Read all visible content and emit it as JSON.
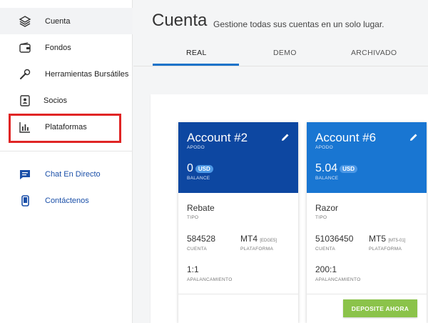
{
  "sidebar": {
    "items": [
      {
        "label": "Cuenta",
        "icon": "layers-icon"
      },
      {
        "label": "Fondos",
        "icon": "wallet-icon"
      },
      {
        "label": "Herramientas Bursátiles",
        "icon": "wrench-icon"
      },
      {
        "label": "Socios",
        "icon": "contacts-book-icon"
      },
      {
        "label": "Plataformas",
        "icon": "bar-chart-icon"
      }
    ],
    "support": [
      {
        "label": "Chat En Directo",
        "icon": "chat-icon"
      },
      {
        "label": "Contáctenos",
        "icon": "phone-icon"
      }
    ]
  },
  "header": {
    "title": "Cuenta",
    "subtitle": "Gestione todas sus cuentas en un solo lugar."
  },
  "tabs": [
    {
      "label": "REAL",
      "active": true
    },
    {
      "label": "DEMO",
      "active": false
    },
    {
      "label": "ARCHIVADO",
      "active": false
    }
  ],
  "accounts": [
    {
      "name": "Account #2",
      "nick_label": "APODO",
      "balance": "0",
      "currency": "USD",
      "balance_label": "BALANCE",
      "type": "Rebate",
      "type_label": "TIPO",
      "account_number": "584528",
      "account_label": "CUENTA",
      "platform": "MT4",
      "platform_sub": "[EDGE5]",
      "platform_label": "PLATAFORMA",
      "leverage": "1:1",
      "leverage_label": "APALANCAMIENTO",
      "header_color": "#0d47a1"
    },
    {
      "name": "Account #6",
      "nick_label": "APODO",
      "balance": "5.04",
      "currency": "USD",
      "balance_label": "BALANCE",
      "type": "Razor",
      "type_label": "TIPO",
      "account_number": "51036450",
      "account_label": "CUENTA",
      "platform": "MT5",
      "platform_sub": "[MT5-01]",
      "platform_label": "PLATAFORMA",
      "leverage": "200:1",
      "leverage_label": "APALANCAMIENTO",
      "deposit_label": "DEPOSITE AHORA",
      "header_color": "#1976d2"
    }
  ],
  "colors": {
    "accent": "#1a73c9",
    "highlight": "#e02525",
    "deposit": "#8bc34a",
    "support_link": "#1a4fa8"
  }
}
